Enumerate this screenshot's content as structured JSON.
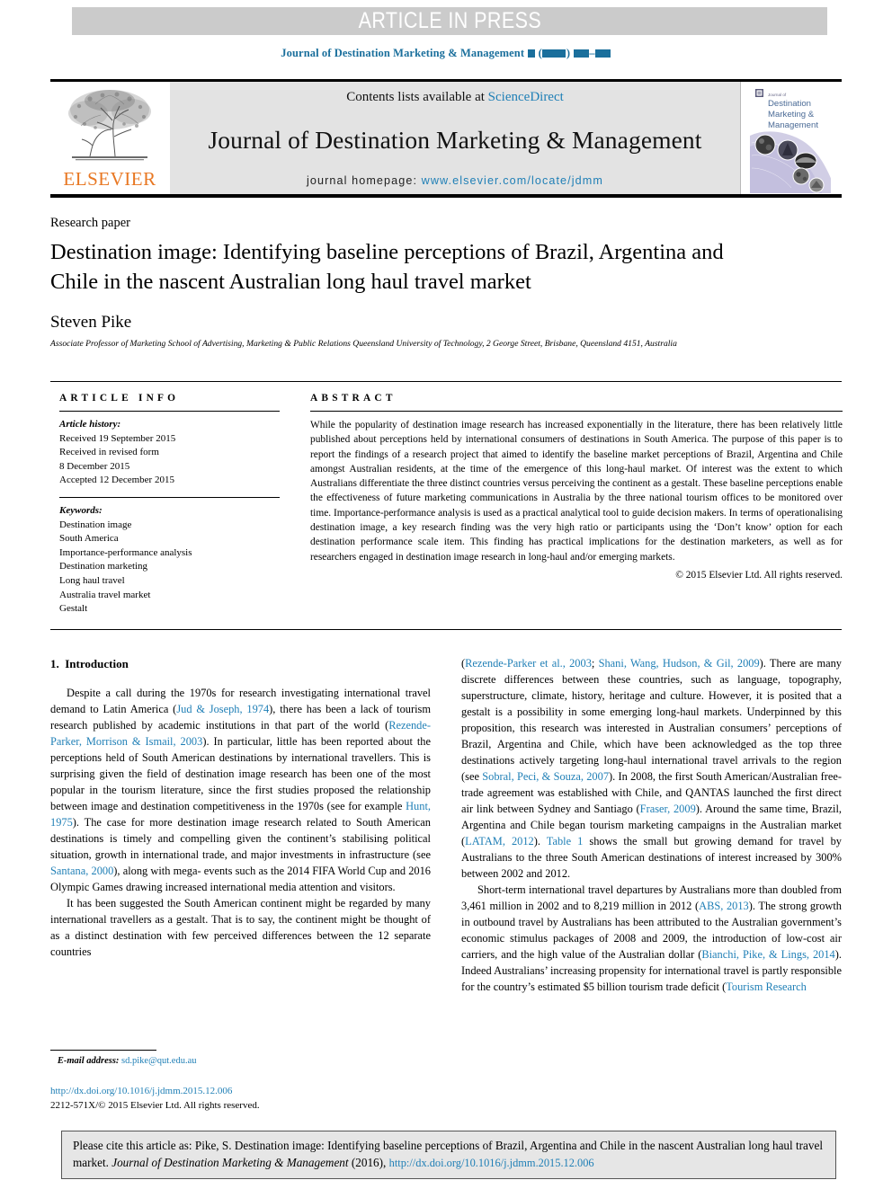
{
  "banner": {
    "text": "ARTICLE IN PRESS"
  },
  "running_head": {
    "journal": "Journal of Destination Marketing & Management",
    "volume_placeholder": "▪",
    "year_placeholder": "(▪▪▪▪)",
    "pages_placeholder": "▪▪▪–▪▪▪"
  },
  "masthead": {
    "publisher_logo_label": "ELSEVIER",
    "contents_prefix": "Contents lists available at",
    "contents_link": "ScienceDirect",
    "journal_title": "Journal of Destination Marketing & Management",
    "homepage_prefix": "journal homepage:",
    "homepage_url": "www.elsevier.com/locate/jdmm",
    "cover": {
      "line1": "Journal of",
      "line2": "Destination",
      "line3": "Marketing &",
      "line4": "Management"
    }
  },
  "article": {
    "type": "Research paper",
    "title": "Destination image: Identifying baseline perceptions of Brazil, Argentina and Chile in the nascent Australian long haul travel market",
    "author": "Steven Pike",
    "affiliation": "Associate Professor of Marketing School of Advertising, Marketing & Public Relations Queensland University of Technology, 2 George Street, Brisbane, Queensland 4151, Australia"
  },
  "article_info": {
    "heading": "ARTICLE INFO",
    "history_label": "Article history:",
    "history": [
      "Received 19 September 2015",
      "Received in revised form",
      "8 December 2015",
      "Accepted 12 December 2015"
    ],
    "keywords_label": "Keywords:",
    "keywords": [
      "Destination image",
      "South America",
      "Importance-performance analysis",
      "Destination marketing",
      "Long haul travel",
      "Australia travel market",
      "Gestalt"
    ]
  },
  "abstract": {
    "heading": "ABSTRACT",
    "body": "While the popularity of destination image research has increased exponentially in the literature, there has been relatively little published about perceptions held by international consumers of destinations in South America. The purpose of this paper is to report the findings of a research project that aimed to identify the baseline market perceptions of Brazil, Argentina and Chile amongst Australian residents, at the time of the emergence of this long-haul market. Of interest was the extent to which Australians differentiate the three distinct countries versus perceiving the continent as a gestalt. These baseline perceptions enable the effectiveness of future marketing communications in Australia by the three national tourism offices to be monitored over time. Importance-performance analysis is used as a practical analytical tool to guide decision makers. In terms of operationalising destination image, a key research finding was the very high ratio or participants using the ‘Don’t know’ option for each destination performance scale item. This finding has practical implications for the destination marketers, as well as for researchers engaged in destination image research in long-haul and/or emerging markets.",
    "copyright": "© 2015 Elsevier Ltd. All rights reserved."
  },
  "introduction": {
    "section_number": "1.",
    "section_title": "Introduction",
    "left_paragraphs": [
      {
        "runs": [
          {
            "t": "Despite a call during the 1970s for research investigating international travel demand to Latin America ("
          },
          {
            "t": "Jud & Joseph, 1974",
            "ref": true
          },
          {
            "t": "), there has been a lack of tourism research published by academic institutions in that part of the world ("
          },
          {
            "t": "Rezende-Parker, Morrison & Ismail, 2003",
            "ref": true
          },
          {
            "t": "). In particular, little has been reported about the perceptions held of South American destinations by international travellers. This is surprising given the field of destination image research has been one of the most popular in the tourism literature, since the first studies proposed the relationship between image and destination competitiveness in the 1970s (see for example "
          },
          {
            "t": "Hunt, 1975",
            "ref": true
          },
          {
            "t": "). The case for more destination image research related to South American destinations is timely and compelling given the continent’s stabilising political situation, growth in international trade, and major investments in infrastructure (see "
          },
          {
            "t": "Santana, 2000",
            "ref": true
          },
          {
            "t": "), along with mega- events such as the 2014 FIFA World Cup and 2016 Olympic Games drawing increased international media attention and visitors."
          }
        ]
      },
      {
        "runs": [
          {
            "t": "It has been suggested the South American continent might be regarded by many international travellers as a gestalt. That is to say, the continent might be thought of as a distinct destination with few perceived differences between the 12 separate countries"
          }
        ]
      }
    ],
    "right_paragraphs": [
      {
        "no_indent": true,
        "runs": [
          {
            "t": "("
          },
          {
            "t": "Rezende-Parker et al., 2003",
            "ref": true
          },
          {
            "t": "; "
          },
          {
            "t": "Shani, Wang, Hudson, & Gil, 2009",
            "ref": true
          },
          {
            "t": "). There are many discrete differences between these countries, such as language, topography, superstructure, climate, history, heritage and culture. However, it is posited that a gestalt is a possibility in some emerging long-haul markets. Underpinned by this proposition, this research was interested in Australian consumers’ perceptions of Brazil, Argentina and Chile, which have been acknowledged as the top three destinations actively targeting long-haul international travel arrivals to the region (see "
          },
          {
            "t": "Sobral, Peci, & Souza, 2007",
            "ref": true
          },
          {
            "t": "). In 2008, the first South American/Australian free-trade agreement was established with Chile, and QANTAS launched the first direct air link between Sydney and Santiago ("
          },
          {
            "t": "Fraser, 2009",
            "ref": true
          },
          {
            "t": "). Around the same time, Brazil, Argentina and Chile began tourism marketing campaigns in the Australian market ("
          },
          {
            "t": "LATAM, 2012",
            "ref": true
          },
          {
            "t": "). "
          },
          {
            "t": "Table 1",
            "ref": true
          },
          {
            "t": " shows the small but growing demand for travel by Australians to the three South American destinations of interest increased by 300% between 2002 and 2012."
          }
        ]
      },
      {
        "runs": [
          {
            "t": "Short-term international travel departures by Australians more than doubled from 3,461 million in 2002 and to 8,219 million in 2012 ("
          },
          {
            "t": "ABS, 2013",
            "ref": true
          },
          {
            "t": "). The strong growth in outbound travel by Australians has been attributed to the Australian government’s economic stimulus packages of 2008 and 2009, the introduction of low-cost air carriers, and the high value of the Australian dollar ("
          },
          {
            "t": "Bianchi, Pike, & Lings, 2014",
            "ref": true
          },
          {
            "t": "). Indeed Australians’ increasing propensity for international travel is partly responsible for the country’s estimated $5 billion tourism trade deficit ("
          },
          {
            "t": "Tourism Research",
            "ref": true
          }
        ]
      }
    ]
  },
  "footer": {
    "email_label": "E-mail address:",
    "email": "sd.pike@qut.edu.au",
    "doi": "http://dx.doi.org/10.1016/j.jdmm.2015.12.006",
    "issn_line": "2212-571X/© 2015 Elsevier Ltd. All rights reserved."
  },
  "cite_box": {
    "prefix": "Please cite this article as: Pike, S. Destination image: Identifying baseline perceptions of Brazil, Argentina and Chile in the nascent Australian long haul travel market.",
    "journal": "Journal of Destination Marketing & Management",
    "year": "(2016),",
    "doi": "http://dx.doi.org/10.1016/j.jdmm.2015.12.006"
  },
  "colors": {
    "link": "#1f7fb6",
    "banner_bg": "#cbcbcb",
    "masthead_bg": "#e3e3e3",
    "elsevier_orange": "#e87722",
    "cite_bg": "#e6e6e6"
  }
}
